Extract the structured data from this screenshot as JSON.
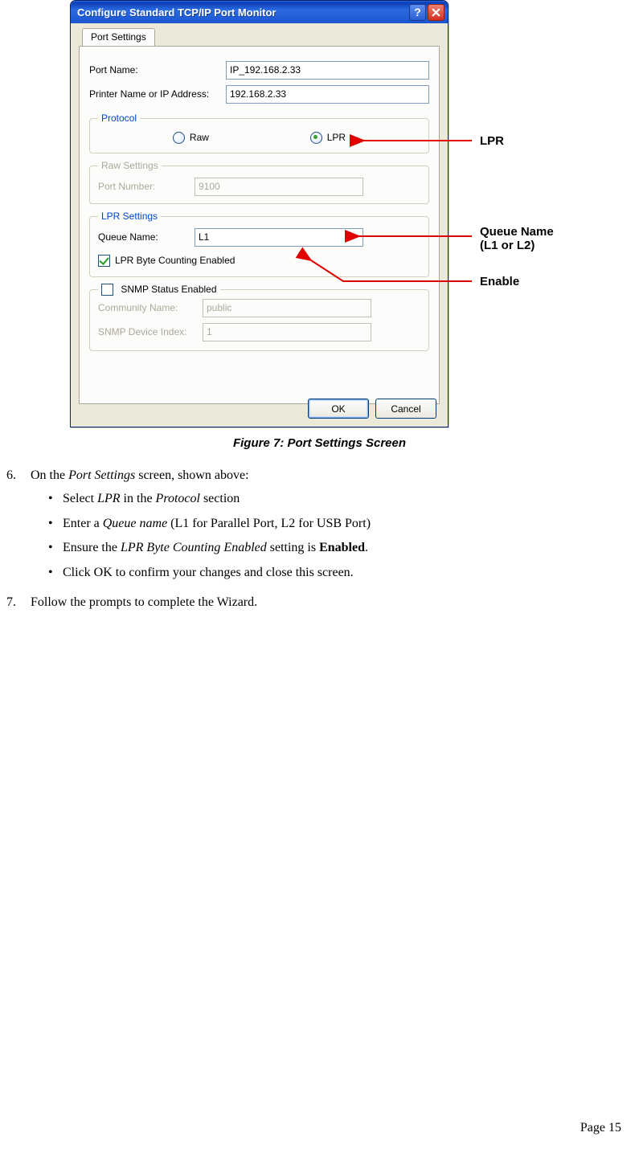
{
  "window": {
    "title": "Configure Standard TCP/IP Port Monitor",
    "tab": "Port Settings",
    "port_name_label": "Port Name:",
    "port_name_value": "IP_192.168.2.33",
    "printer_label": "Printer Name or IP Address:",
    "printer_value": "192.168.2.33",
    "protocol_legend": "Protocol",
    "protocol_raw": "Raw",
    "protocol_lpr": "LPR",
    "raw_legend": "Raw Settings",
    "raw_port_label": "Port Number:",
    "raw_port_value": "9100",
    "lpr_legend": "LPR Settings",
    "lpr_queue_label": "Queue Name:",
    "lpr_queue_value": "L1",
    "lpr_byte_label": "LPR Byte Counting Enabled",
    "snmp_checkbox_label": "SNMP Status Enabled",
    "snmp_comm_label": "Community Name:",
    "snmp_comm_value": "public",
    "snmp_idx_label": "SNMP Device Index:",
    "snmp_idx_value": "1",
    "ok": "OK",
    "cancel": "Cancel"
  },
  "callouts": {
    "lpr": "LPR",
    "queue1": "Queue Name",
    "queue2": "(L1 or L2)",
    "enable": "Enable"
  },
  "caption": "Figure 7: Port Settings Screen",
  "step6": {
    "num": "6.",
    "intro_a": "On the ",
    "intro_i": "Port Settings",
    "intro_b": " screen, shown above:",
    "b1_a": "Select ",
    "b1_i": "LPR",
    "b1_b": " in the ",
    "b1_i2": "Protocol",
    "b1_c": " section",
    "b2_a": "Enter a ",
    "b2_i": "Queue name",
    "b2_b": " (L1 for Parallel Port, L2 for USB Port)",
    "b3_a": "Ensure the ",
    "b3_i": "LPR Byte Counting Enabled",
    "b3_b": " setting is ",
    "b3_bold": "Enabled",
    "b3_c": ".",
    "b4": "Click OK to confirm your changes and close this screen."
  },
  "step7": {
    "num": "7.",
    "text": "Follow the prompts to complete the Wizard."
  },
  "page_number": "Page 15"
}
